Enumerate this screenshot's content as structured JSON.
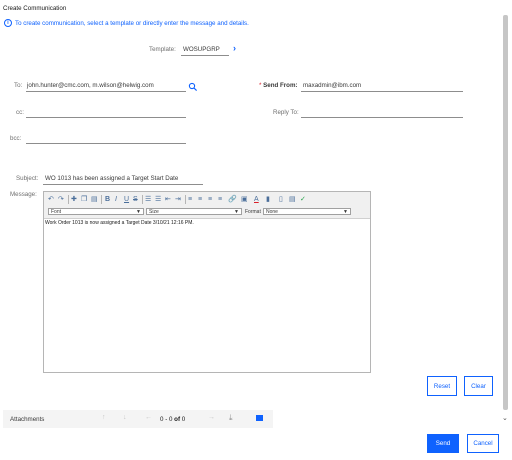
{
  "page": {
    "title": "Create Communication",
    "info_text": "To create communication, select a template or directly enter the message and details."
  },
  "form": {
    "template_label": "Template:",
    "template_value": "WOSUPGRP",
    "to_label": "To:",
    "to_value": "john.hunter@cmc.com, m.wilson@helwig.com",
    "send_from_label": "Send From:",
    "send_from_value": "maxadmin@ibm.com",
    "cc_label": "cc:",
    "cc_value": "",
    "reply_to_label": "Reply To:",
    "reply_to_value": "",
    "bcc_label": "bcc:",
    "bcc_value": "",
    "subject_label": "Subject:",
    "subject_value": "WO 1013 has been assigned a Target Start Date",
    "message_label": "Message:"
  },
  "editor": {
    "font_placeholder": "Font",
    "size_placeholder": "Size",
    "format_label": "Format",
    "format_value": "None",
    "body_text": "Work Order 1013 is now assigned a Target Date 3/10/21 12:16 PM."
  },
  "buttons": {
    "reset": "Reset",
    "clear": "Clear",
    "send": "Send",
    "cancel": "Cancel"
  },
  "attachments": {
    "label": "Attachments",
    "pager_start": "0",
    "pager_sep": "-",
    "pager_end": "0",
    "pager_of": "of",
    "pager_total": "0"
  },
  "colors": {
    "accent": "#0f62fe",
    "required": "#da1e28",
    "panel_bg": "#f4f4f4"
  }
}
